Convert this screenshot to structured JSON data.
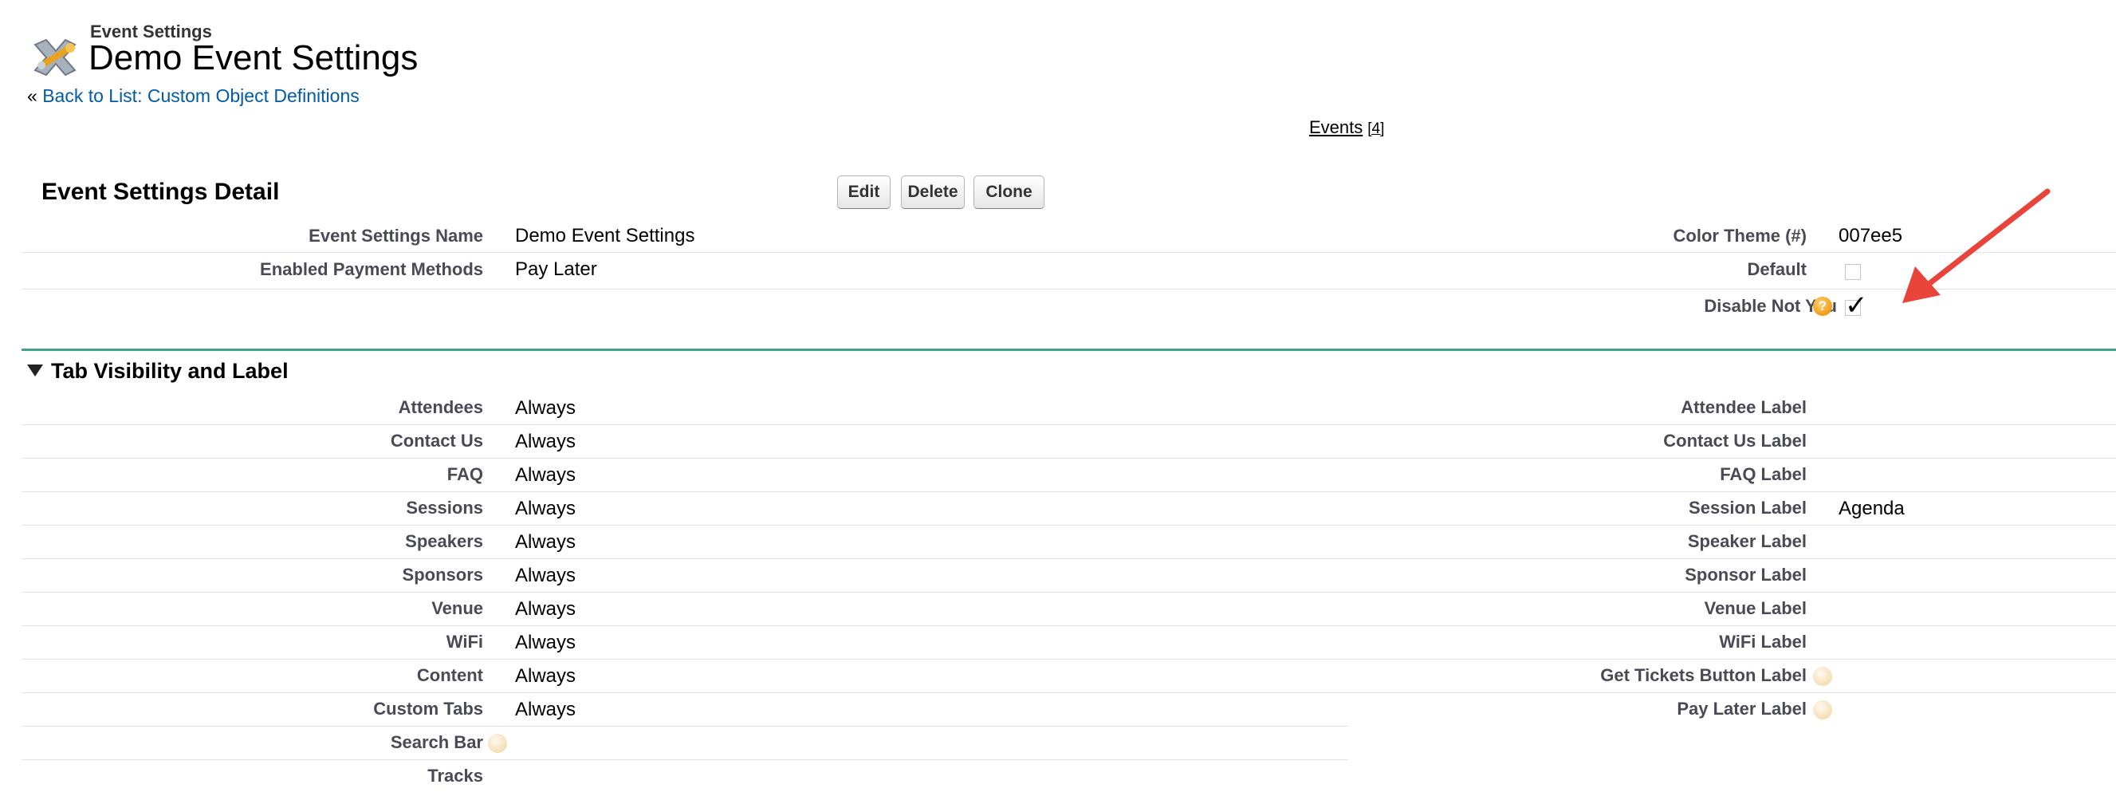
{
  "header": {
    "object_type": "Event Settings",
    "title": "Demo Event Settings",
    "back_prefix": "«",
    "back_link": "Back to List: Custom Object Definitions"
  },
  "related": {
    "label": "Events",
    "count": "[4]"
  },
  "detail": {
    "title": "Event Settings Detail",
    "buttons": {
      "edit": "Edit",
      "delete": "Delete",
      "clone": "Clone"
    },
    "left_fields": [
      {
        "label": "Event Settings Name",
        "value": "Demo Event Settings"
      },
      {
        "label": "Enabled Payment Methods",
        "value": "Pay Later"
      }
    ],
    "right_fields": [
      {
        "label": "Color Theme (#)",
        "value": "007ee5"
      },
      {
        "label": "Default",
        "checked": false
      },
      {
        "label": "Disable Not You",
        "checked": true
      }
    ]
  },
  "tab_section": {
    "title": "Tab Visibility and Label",
    "left_fields": [
      {
        "label": "Attendees",
        "value": "Always"
      },
      {
        "label": "Contact Us",
        "value": "Always"
      },
      {
        "label": "FAQ",
        "value": "Always"
      },
      {
        "label": "Sessions",
        "value": "Always"
      },
      {
        "label": "Speakers",
        "value": "Always"
      },
      {
        "label": "Sponsors",
        "value": "Always"
      },
      {
        "label": "Venue",
        "value": "Always"
      },
      {
        "label": "WiFi",
        "value": "Always"
      },
      {
        "label": "Content",
        "value": "Always"
      },
      {
        "label": "Custom Tabs",
        "value": "Always"
      },
      {
        "label": "Search Bar",
        "value": ""
      },
      {
        "label": "Tracks",
        "value": ""
      }
    ],
    "right_fields": [
      {
        "label": "Attendee Label",
        "value": ""
      },
      {
        "label": "Contact Us Label",
        "value": ""
      },
      {
        "label": "FAQ Label",
        "value": ""
      },
      {
        "label": "Session Label",
        "value": "Agenda"
      },
      {
        "label": "Speaker Label",
        "value": ""
      },
      {
        "label": "Sponsor Label",
        "value": ""
      },
      {
        "label": "Venue Label",
        "value": ""
      },
      {
        "label": "WiFi Label",
        "value": ""
      },
      {
        "label": "Get Tickets Button Label",
        "value": ""
      },
      {
        "label": "Pay Later Label",
        "value": ""
      }
    ]
  },
  "icons": {
    "header": "event-settings-icon",
    "help": "help-icon",
    "arrow": "red-arrow-annotation"
  },
  "colors": {
    "link": "#015ba7",
    "section_line": "#3fa58f",
    "annotation": "#e8443a",
    "help": "#f29b13"
  }
}
